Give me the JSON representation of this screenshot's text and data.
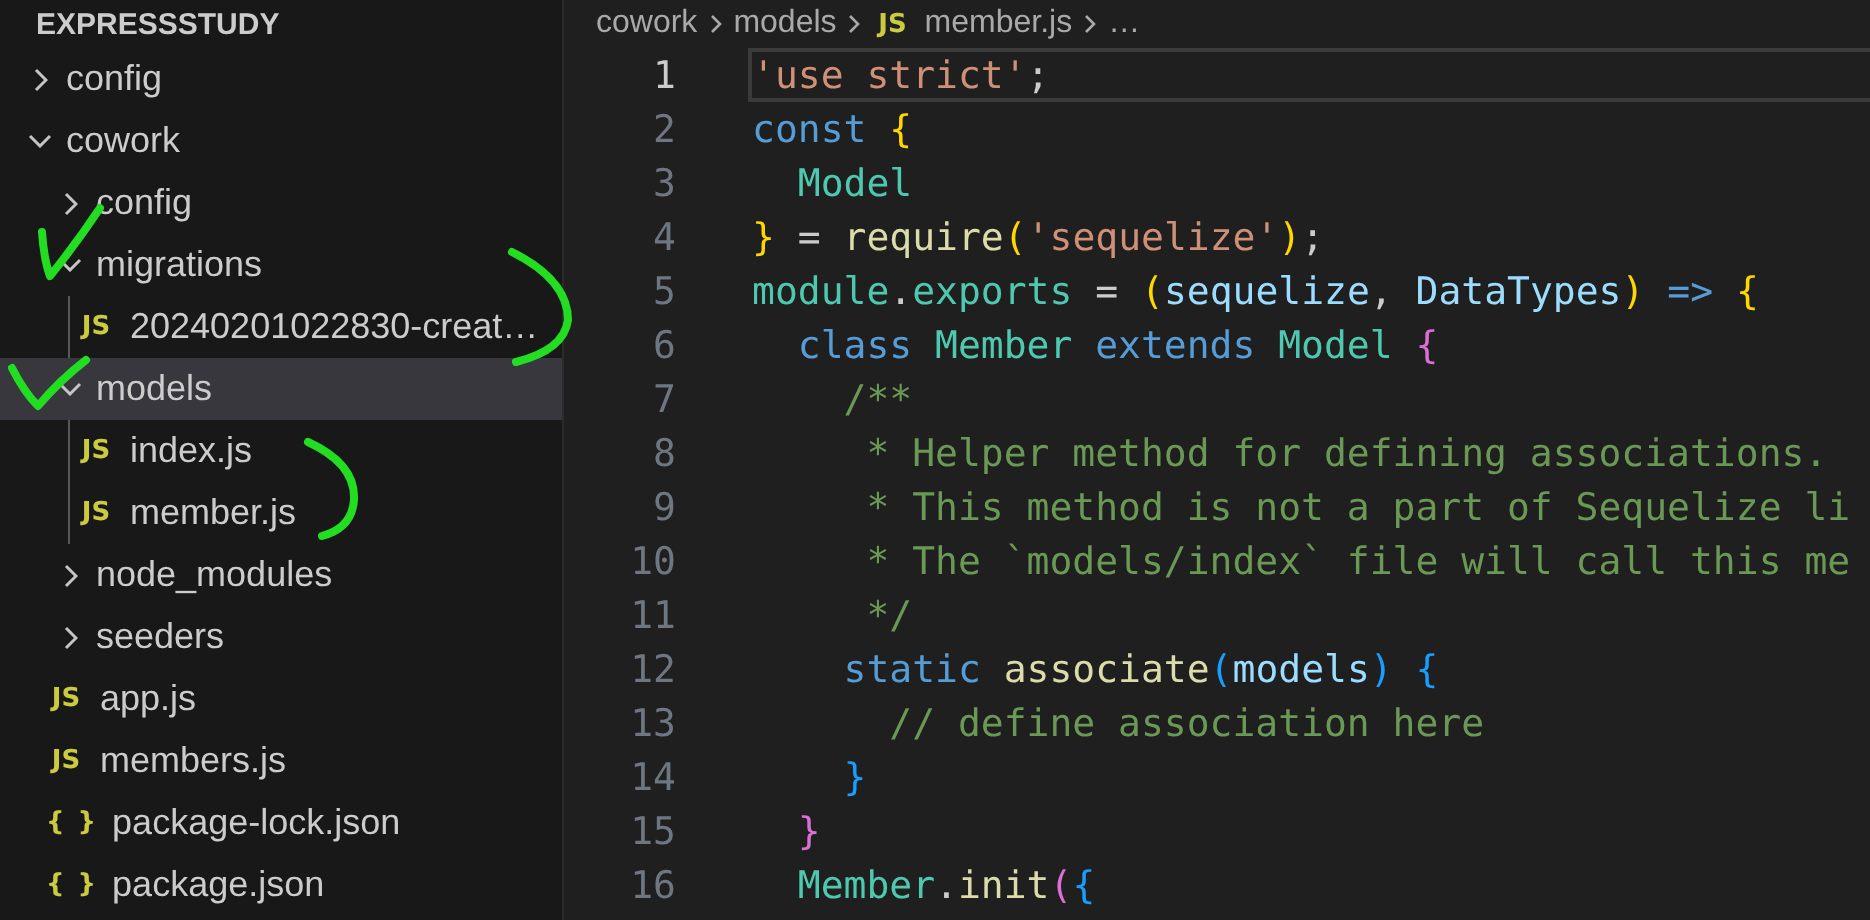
{
  "explorer": {
    "title": "EXPRESSSTUDY",
    "items": [
      {
        "label": "config",
        "kind": "folder",
        "expanded": false,
        "selected": false
      },
      {
        "label": "cowork",
        "kind": "folder",
        "expanded": true,
        "selected": false,
        "children": [
          {
            "label": "config",
            "kind": "folder",
            "expanded": false,
            "selected": false
          },
          {
            "label": "migrations",
            "kind": "folder",
            "expanded": true,
            "selected": false,
            "children": [
              {
                "label": "20240201022830-creat…",
                "kind": "file",
                "icon": "JS",
                "selected": false
              }
            ]
          },
          {
            "label": "models",
            "kind": "folder",
            "expanded": true,
            "selected": true,
            "children": [
              {
                "label": "index.js",
                "kind": "file",
                "icon": "JS",
                "selected": false
              },
              {
                "label": "member.js",
                "kind": "file",
                "icon": "JS",
                "selected": false
              }
            ]
          },
          {
            "label": "node_modules",
            "kind": "folder",
            "expanded": false,
            "selected": false
          },
          {
            "label": "seeders",
            "kind": "folder",
            "expanded": false,
            "selected": false
          },
          {
            "label": "app.js",
            "kind": "file",
            "icon": "JS",
            "selected": false
          },
          {
            "label": "members.js",
            "kind": "file",
            "icon": "JS",
            "selected": false
          },
          {
            "label": "package-lock.json",
            "kind": "file",
            "icon": "{ }",
            "selected": false
          },
          {
            "label": "package.json",
            "kind": "file",
            "icon": "{ }",
            "selected": false
          }
        ]
      }
    ]
  },
  "breadcrumb": [
    {
      "label": "cowork"
    },
    {
      "label": "models"
    },
    {
      "label": "member.js",
      "icon": "JS"
    },
    {
      "label": "…"
    }
  ],
  "editor": {
    "lines": [
      {
        "number": "1",
        "current": true,
        "tokens": [
          {
            "t": "'use strict'",
            "color": "#ce9178"
          },
          {
            "t": ";",
            "color": "#cccccc"
          }
        ]
      },
      {
        "number": "2",
        "current": false,
        "tokens": [
          {
            "t": "const ",
            "color": "#569cd6"
          },
          {
            "t": "{",
            "color": "#ffd700"
          }
        ]
      },
      {
        "number": "3",
        "current": false,
        "tokens": [
          {
            "t": "  Model",
            "color": "#4ec9b0"
          }
        ]
      },
      {
        "number": "4",
        "current": false,
        "tokens": [
          {
            "t": "}",
            "color": "#ffd700"
          },
          {
            "t": " = ",
            "color": "#cccccc"
          },
          {
            "t": "require",
            "color": "#dcdcaa"
          },
          {
            "t": "(",
            "color": "#ffd700"
          },
          {
            "t": "'sequelize'",
            "color": "#ce9178"
          },
          {
            "t": ")",
            "color": "#ffd700"
          },
          {
            "t": ";",
            "color": "#cccccc"
          }
        ]
      },
      {
        "number": "5",
        "current": false,
        "tokens": [
          {
            "t": "module",
            "color": "#4ec9b0"
          },
          {
            "t": ".",
            "color": "#cccccc"
          },
          {
            "t": "exports",
            "color": "#4ec9b0"
          },
          {
            "t": " = ",
            "color": "#cccccc"
          },
          {
            "t": "(",
            "color": "#ffd700"
          },
          {
            "t": "sequelize",
            "color": "#9cdcfe"
          },
          {
            "t": ", ",
            "color": "#cccccc"
          },
          {
            "t": "DataTypes",
            "color": "#9cdcfe"
          },
          {
            "t": ") ",
            "color": "#ffd700"
          },
          {
            "t": "=> ",
            "color": "#569cd6"
          },
          {
            "t": "{",
            "color": "#ffd700"
          }
        ]
      },
      {
        "number": "6",
        "current": false,
        "tokens": [
          {
            "t": "  class ",
            "color": "#569cd6"
          },
          {
            "t": "Member ",
            "color": "#4ec9b0"
          },
          {
            "t": "extends ",
            "color": "#569cd6"
          },
          {
            "t": "Model ",
            "color": "#4ec9b0"
          },
          {
            "t": "{",
            "color": "#da70d6"
          }
        ]
      },
      {
        "number": "7",
        "current": false,
        "tokens": [
          {
            "t": "    /**",
            "color": "#6a9955"
          }
        ]
      },
      {
        "number": "8",
        "current": false,
        "tokens": [
          {
            "t": "     * Helper method for defining associations.",
            "color": "#6a9955"
          }
        ]
      },
      {
        "number": "9",
        "current": false,
        "tokens": [
          {
            "t": "     * This method is not a part of Sequelize li",
            "color": "#6a9955"
          }
        ]
      },
      {
        "number": "10",
        "current": false,
        "tokens": [
          {
            "t": "     * The `models/index` file will call this me",
            "color": "#6a9955"
          }
        ]
      },
      {
        "number": "11",
        "current": false,
        "tokens": [
          {
            "t": "     */",
            "color": "#6a9955"
          }
        ]
      },
      {
        "number": "12",
        "current": false,
        "tokens": [
          {
            "t": "    static ",
            "color": "#569cd6"
          },
          {
            "t": "associate",
            "color": "#dcdcaa"
          },
          {
            "t": "(",
            "color": "#179fff"
          },
          {
            "t": "models",
            "color": "#9cdcfe"
          },
          {
            "t": ") {",
            "color": "#179fff"
          }
        ]
      },
      {
        "number": "13",
        "current": false,
        "tokens": [
          {
            "t": "      // define association here",
            "color": "#6a9955"
          }
        ]
      },
      {
        "number": "14",
        "current": false,
        "tokens": [
          {
            "t": "    }",
            "color": "#179fff"
          }
        ]
      },
      {
        "number": "15",
        "current": false,
        "tokens": [
          {
            "t": "  }",
            "color": "#da70d6"
          }
        ]
      },
      {
        "number": "16",
        "current": false,
        "tokens": [
          {
            "t": "  Member",
            "color": "#4ec9b0"
          },
          {
            "t": ".",
            "color": "#cccccc"
          },
          {
            "t": "init",
            "color": "#dcdcaa"
          },
          {
            "t": "(",
            "color": "#da70d6"
          },
          {
            "t": "{",
            "color": "#179fff"
          }
        ]
      }
    ]
  }
}
